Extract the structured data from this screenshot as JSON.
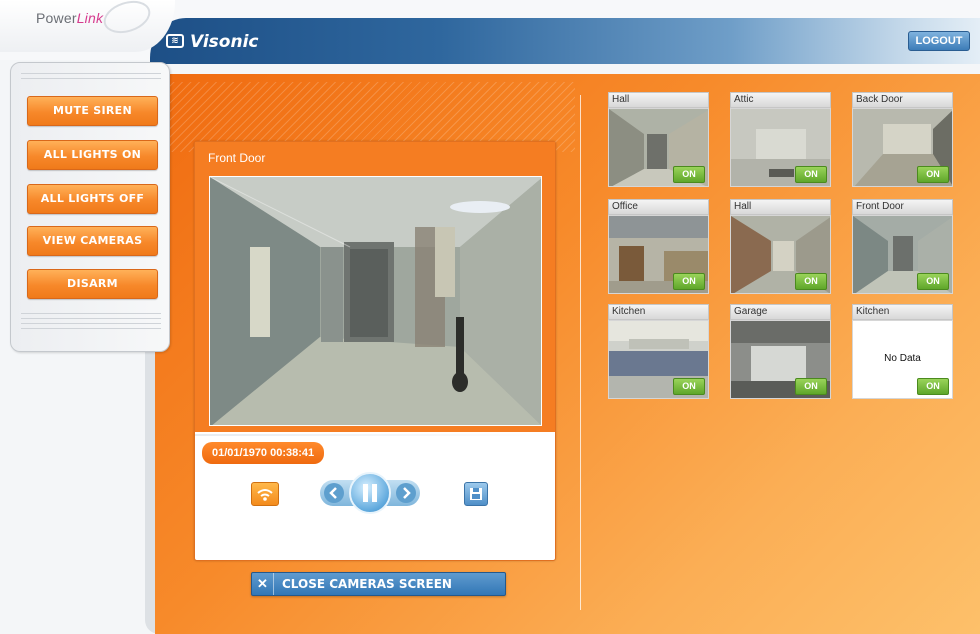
{
  "brand": {
    "product_pre": "Power",
    "product_link": "Link",
    "company": "Visonic"
  },
  "header": {
    "logout_label": "LOGOUT"
  },
  "commands": [
    {
      "label": "MUTE SIREN"
    },
    {
      "label": "ALL LIGHTS ON"
    },
    {
      "label": "ALL LIGHTS OFF"
    },
    {
      "label": "VIEW CAMERAS"
    },
    {
      "label": "DISARM"
    }
  ],
  "viewer": {
    "title": "Front Door",
    "timestamp": "01/01/1970 00:38:41",
    "close_label": "CLOSE CAMERAS SCREEN",
    "close_glyph": "✕"
  },
  "cameras": [
    {
      "name": "Hall",
      "status": "ON",
      "scene": "hallway"
    },
    {
      "name": "Attic",
      "status": "ON",
      "scene": "room"
    },
    {
      "name": "Back Door",
      "status": "ON",
      "scene": "corridor"
    },
    {
      "name": "Office",
      "status": "ON",
      "scene": "office"
    },
    {
      "name": "Hall",
      "status": "ON",
      "scene": "hallway"
    },
    {
      "name": "Front Door",
      "status": "ON",
      "scene": "corridor"
    },
    {
      "name": "Kitchen",
      "status": "ON",
      "scene": "kitchen"
    },
    {
      "name": "Garage",
      "status": "ON",
      "scene": "garage"
    },
    {
      "name": "Kitchen",
      "status": "ON",
      "scene": "nodata",
      "message": "No Data"
    }
  ],
  "icons": {
    "wifi": "wifi-icon",
    "prev": "chevron-left-icon",
    "pause": "pause-icon",
    "next": "chevron-right-icon",
    "save": "floppy-icon"
  },
  "colors": {
    "accent_orange": "#f57d22",
    "header_blue": "#1d4f86",
    "on_green": "#6fb536"
  }
}
